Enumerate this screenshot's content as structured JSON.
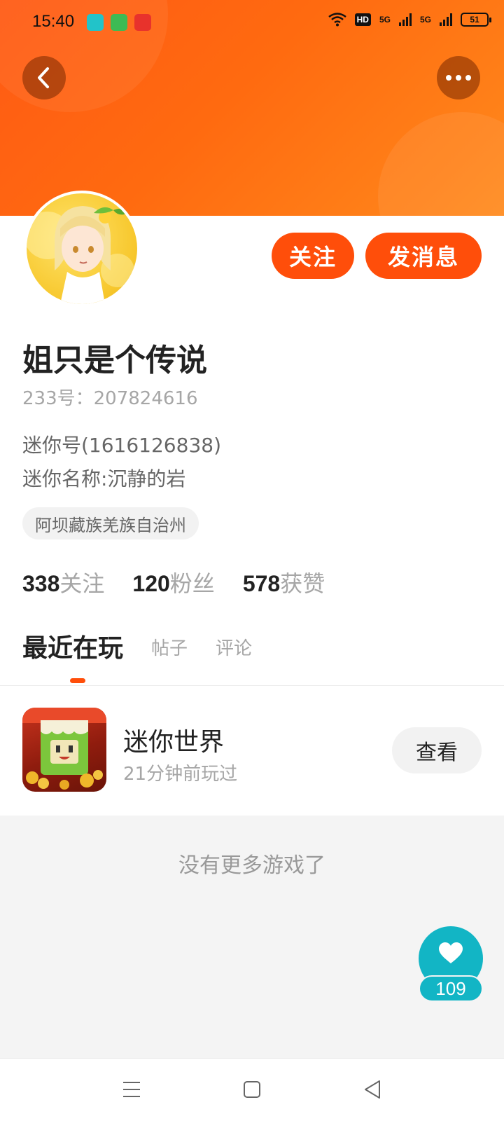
{
  "status_bar": {
    "time": "15:40",
    "network_label": "HD",
    "signal_1": "5G",
    "signal_2": "5G",
    "battery": "51"
  },
  "profile": {
    "nickname": "姐只是个传说",
    "uid": "233号：207824616",
    "mini_id": "迷你号(1616126838)",
    "mini_name": "迷你名称:沉静的岩",
    "location": "阿坝藏族羌族自治州"
  },
  "actions": {
    "follow_label": "关注",
    "message_label": "发消息"
  },
  "stats": {
    "following_count": "338",
    "following_label": "关注",
    "fans_count": "120",
    "fans_label": "粉丝",
    "likes_count": "578",
    "likes_label": "获赞"
  },
  "tabs": [
    {
      "label": "最近在玩",
      "active": true
    },
    {
      "label": "帖子",
      "active": false
    },
    {
      "label": "评论",
      "active": false
    }
  ],
  "recent_games": [
    {
      "name": "迷你世界",
      "time": "21分钟前玩过",
      "action_label": "查看"
    }
  ],
  "empty_message": "没有更多游戏了",
  "like_fab": {
    "count": "109"
  },
  "colors": {
    "brand_orange": "#ff4e0a",
    "header_orange": "#ff6a10",
    "like_teal": "#12b5c5"
  }
}
